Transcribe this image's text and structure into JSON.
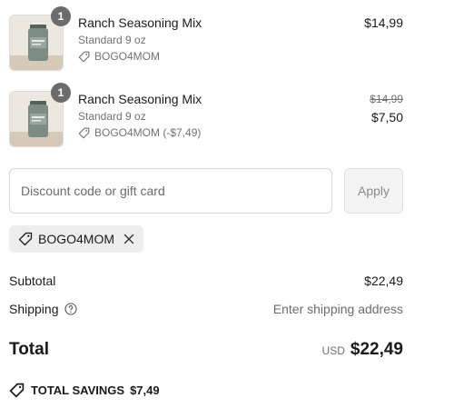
{
  "items": [
    {
      "quantity": "1",
      "name": "Ranch Seasoning Mix",
      "variant": "Standard 9 oz",
      "discount": "BOGO4MOM",
      "price": "$14,99",
      "icon": "tag-icon"
    },
    {
      "quantity": "1",
      "name": "Ranch Seasoning Mix",
      "variant": "Standard 9 oz",
      "discount": "BOGO4MOM (-$7,49)",
      "original_price": "$14,99",
      "price": "$7,50",
      "icon": "tag-icon"
    }
  ],
  "discount_form": {
    "placeholder": "Discount code or gift card",
    "value": "",
    "apply_label": "Apply"
  },
  "applied_code": {
    "code": "BOGO4MOM",
    "icon": "tag-icon",
    "remove_icon": "close-icon"
  },
  "summary": {
    "subtotal_label": "Subtotal",
    "subtotal_value": "$22,49",
    "shipping_label": "Shipping",
    "shipping_value": "Enter shipping address",
    "total_label": "Total",
    "currency": "USD",
    "total_value": "$22,49",
    "savings_label": "TOTAL SAVINGS",
    "savings_value": "$7,49"
  },
  "colors": {
    "badge": "#6b6b6b",
    "chip_bg": "#ededed",
    "apply_bg": "#f3f3f3",
    "muted_text": "#707070"
  }
}
